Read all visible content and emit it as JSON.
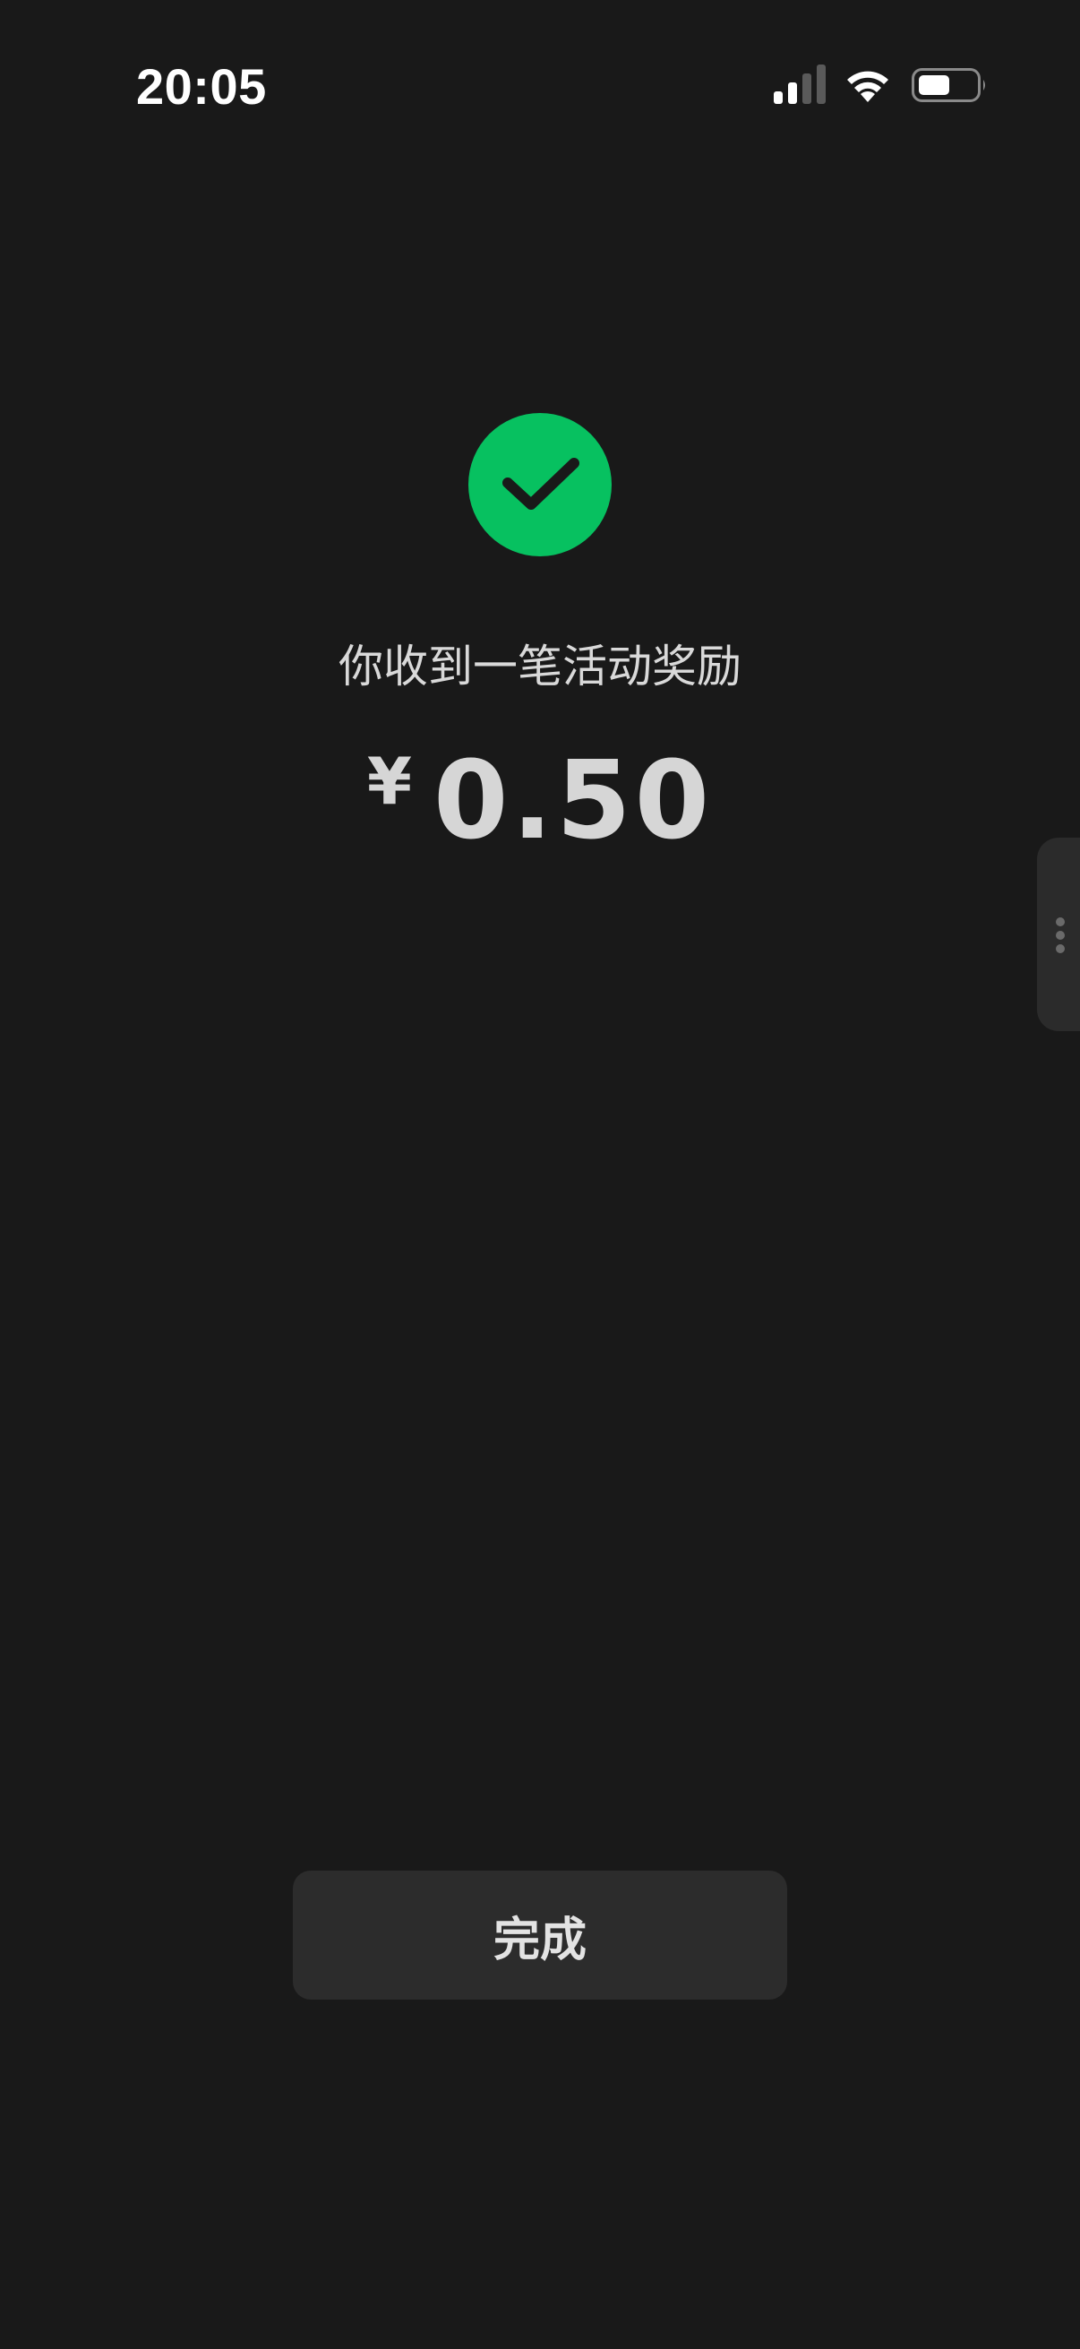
{
  "status_bar": {
    "time": "20:05",
    "icons": [
      "cellular-signal-icon",
      "wifi-icon",
      "battery-icon"
    ]
  },
  "result": {
    "icon": "check-circle-icon",
    "icon_color": "#07c160",
    "message": "你收到一笔活动奖励",
    "currency_symbol": "¥",
    "amount": "0.50"
  },
  "side_handle": {
    "icon": "more-vertical-icon"
  },
  "actions": {
    "done_label": "完成"
  },
  "colors": {
    "background": "#191919",
    "button_background": "#2c2c2c",
    "accent": "#07c160"
  }
}
